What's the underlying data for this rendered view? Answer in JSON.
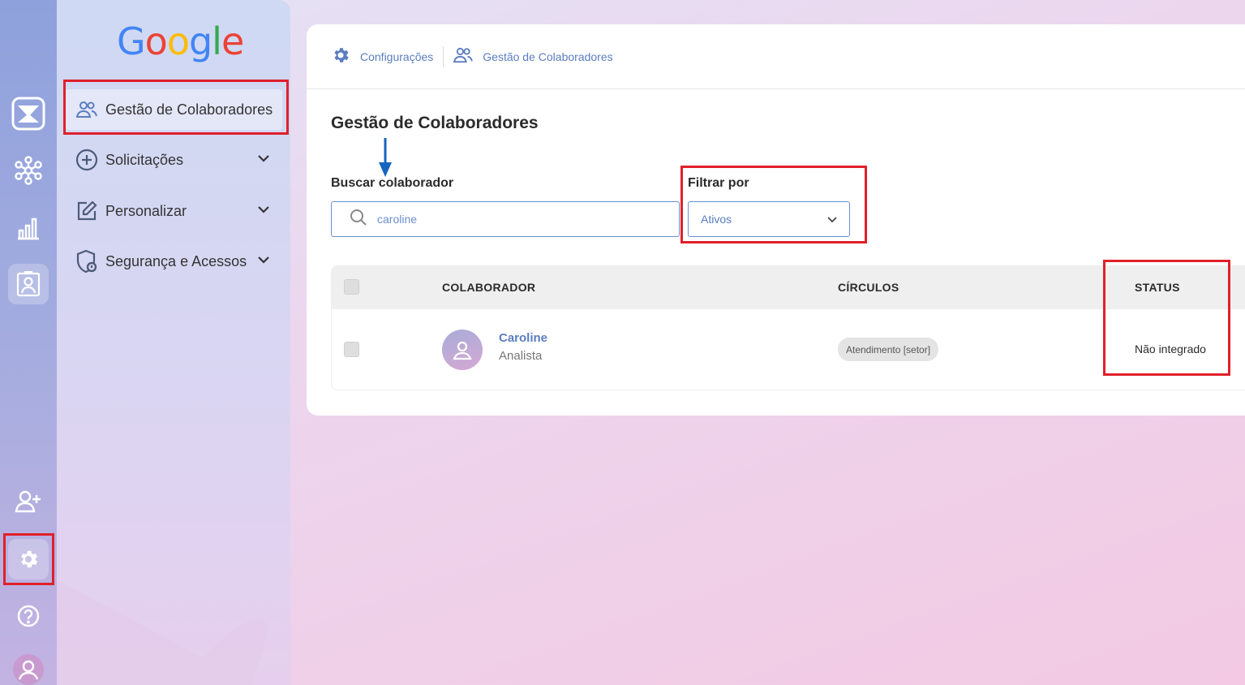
{
  "app": {
    "logo_text": "Google"
  },
  "rail": {
    "items": [
      {
        "icon": "inbox-icon"
      },
      {
        "icon": "network-icon"
      },
      {
        "icon": "chart-icon"
      },
      {
        "icon": "badge-icon"
      },
      {
        "icon": "add-user-icon"
      },
      {
        "icon": "gear-icon"
      },
      {
        "icon": "help-icon"
      },
      {
        "icon": "user-avatar-icon"
      }
    ]
  },
  "sidebar": {
    "items": [
      {
        "label": "Gestão de Colaboradores",
        "icon": "users-icon",
        "active": true
      },
      {
        "label": "Solicitações",
        "icon": "plus-circle-icon",
        "expandable": true
      },
      {
        "label": "Personalizar",
        "icon": "edit-icon",
        "expandable": true
      },
      {
        "label": "Segurança e Acessos",
        "icon": "shield-icon",
        "expandable": true
      }
    ]
  },
  "breadcrumb": {
    "items": [
      {
        "label": "Configurações",
        "icon": "gear-icon"
      },
      {
        "label": "Gestão de Colaboradores",
        "icon": "users-icon"
      }
    ]
  },
  "main": {
    "title": "Gestão de Colaboradores",
    "search": {
      "label": "Buscar colaborador",
      "value": "caroline"
    },
    "filter": {
      "label": "Filtrar por",
      "selected": "Ativos"
    },
    "table": {
      "headers": {
        "collaborator": "COLABORADOR",
        "circles": "CÍRCULOS",
        "status": "STATUS"
      },
      "rows": [
        {
          "name": "Caroline",
          "role": "Analista",
          "circle": "Atendimento [setor]",
          "status": "Não integrado"
        }
      ]
    }
  },
  "colors": {
    "accent": "#5a7dc0",
    "highlight_box": "#e0202a",
    "arrow": "#1565c0"
  }
}
